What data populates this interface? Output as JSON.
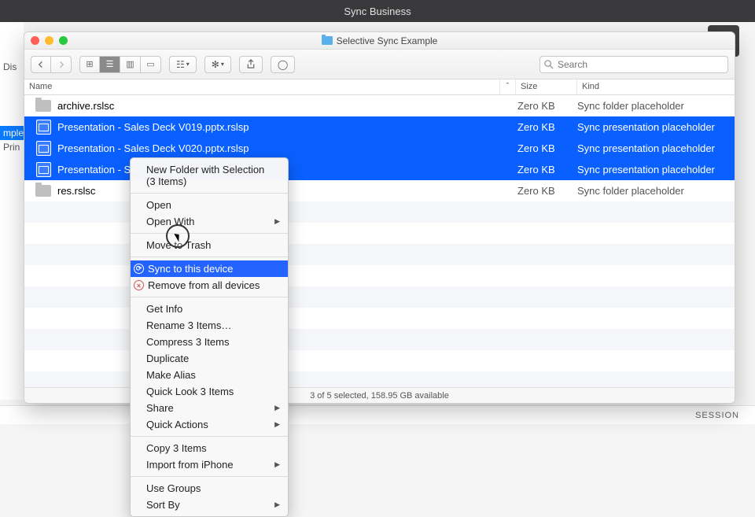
{
  "bg": {
    "topbar_title": "Sync Business",
    "left_items": [
      "Dis",
      "",
      "",
      "",
      "",
      "mple",
      "Prin"
    ],
    "footer": "SESSION"
  },
  "window": {
    "title": "Selective Sync Example",
    "search_placeholder": "Search",
    "columns": {
      "name": "Name",
      "size": "Size",
      "kind": "Kind",
      "sort": "ˆ"
    },
    "rows": [
      {
        "name": "archive.rslsc",
        "size": "Zero KB",
        "kind": "Sync folder placeholder",
        "icon": "folder",
        "selected": false
      },
      {
        "name": "Presentation - Sales Deck V019.pptx.rslsp",
        "size": "Zero KB",
        "kind": "Sync presentation placeholder",
        "icon": "pres",
        "selected": true
      },
      {
        "name": "Presentation - Sales Deck V020.pptx.rslsp",
        "size": "Zero KB",
        "kind": "Sync presentation placeholder",
        "icon": "pres",
        "selected": true
      },
      {
        "name": "Presentation - Sales Deck V021.pptx.rslsp",
        "size": "Zero KB",
        "kind": "Sync presentation placeholder",
        "icon": "pres",
        "selected": true
      },
      {
        "name": "res.rslsc",
        "size": "Zero KB",
        "kind": "Sync folder placeholder",
        "icon": "folder",
        "selected": false
      }
    ],
    "status": "3 of 5 selected, 158.95 GB available"
  },
  "context_menu": {
    "groups": [
      [
        {
          "label": "New Folder with Selection (3 Items)"
        }
      ],
      [
        {
          "label": "Open"
        },
        {
          "label": "Open With",
          "submenu": true
        }
      ],
      [
        {
          "label": "Move to Trash"
        }
      ],
      [
        {
          "label": "Sync to this device",
          "icon": "sync",
          "highlighted": true
        },
        {
          "label": "Remove from all devices",
          "icon": "remove"
        }
      ],
      [
        {
          "label": "Get Info"
        },
        {
          "label": "Rename 3 Items…"
        },
        {
          "label": "Compress 3 Items"
        },
        {
          "label": "Duplicate"
        },
        {
          "label": "Make Alias"
        },
        {
          "label": "Quick Look 3 Items"
        },
        {
          "label": "Share",
          "submenu": true
        },
        {
          "label": "Quick Actions",
          "submenu": true
        }
      ],
      [
        {
          "label": "Copy 3 Items"
        },
        {
          "label": "Import from iPhone",
          "submenu": true
        }
      ],
      [
        {
          "label": "Use Groups"
        },
        {
          "label": "Sort By",
          "submenu": true
        }
      ]
    ]
  }
}
